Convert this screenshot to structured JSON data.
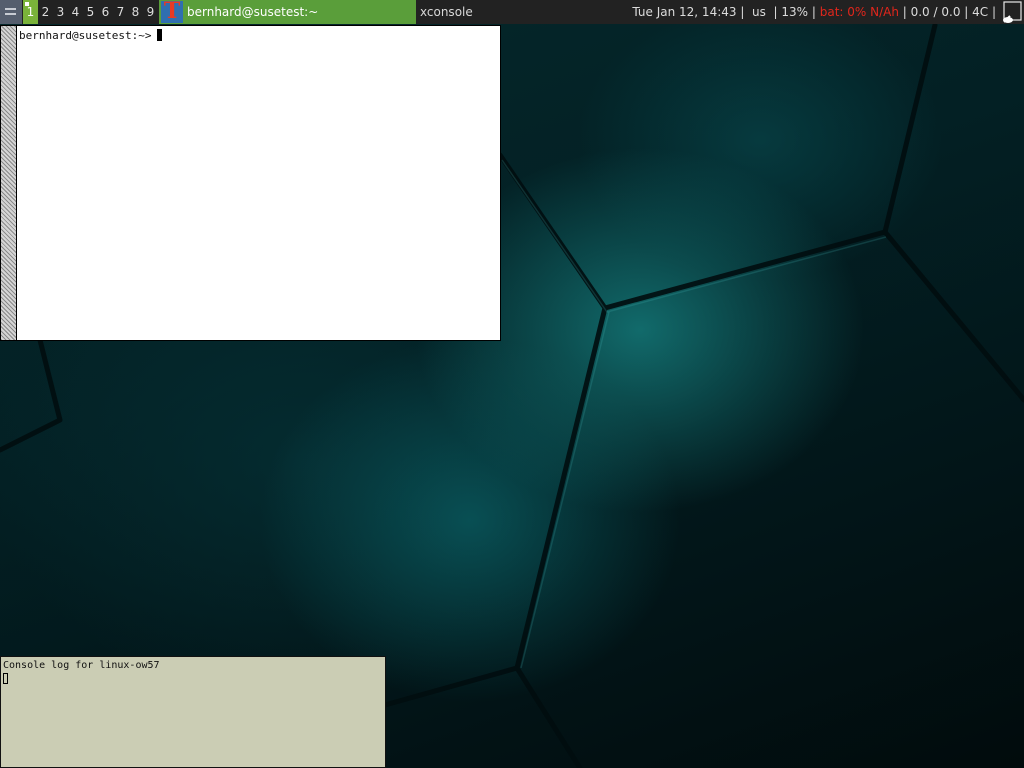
{
  "topbar": {
    "active_tag": "1",
    "tags": [
      "2",
      "3",
      "4",
      "5",
      "6",
      "7",
      "8",
      "9"
    ],
    "active_window_title": "bernhard@susetest:~",
    "inactive_window_title": "xconsole",
    "status": {
      "datetime": "Tue Jan 12, 14:43",
      "keyboard_layout": "us",
      "volume": "13%",
      "battery": "bat: 0% N/Ah",
      "load1": "0.0 / 0.0",
      "cpu": "4C"
    },
    "icons": {
      "layout": "tiling-layout-icon",
      "app": "xterm-icon",
      "tray": "tray-icon"
    },
    "colors": {
      "bar_bg": "#222222",
      "active_tag": "#7ab33a",
      "active_title": "#5a9e3a",
      "battery_warning": "#e0261c"
    }
  },
  "terminal": {
    "prompt": "bernhard@susetest:~>"
  },
  "xconsole": {
    "header": "Console log for linux-ow57"
  }
}
